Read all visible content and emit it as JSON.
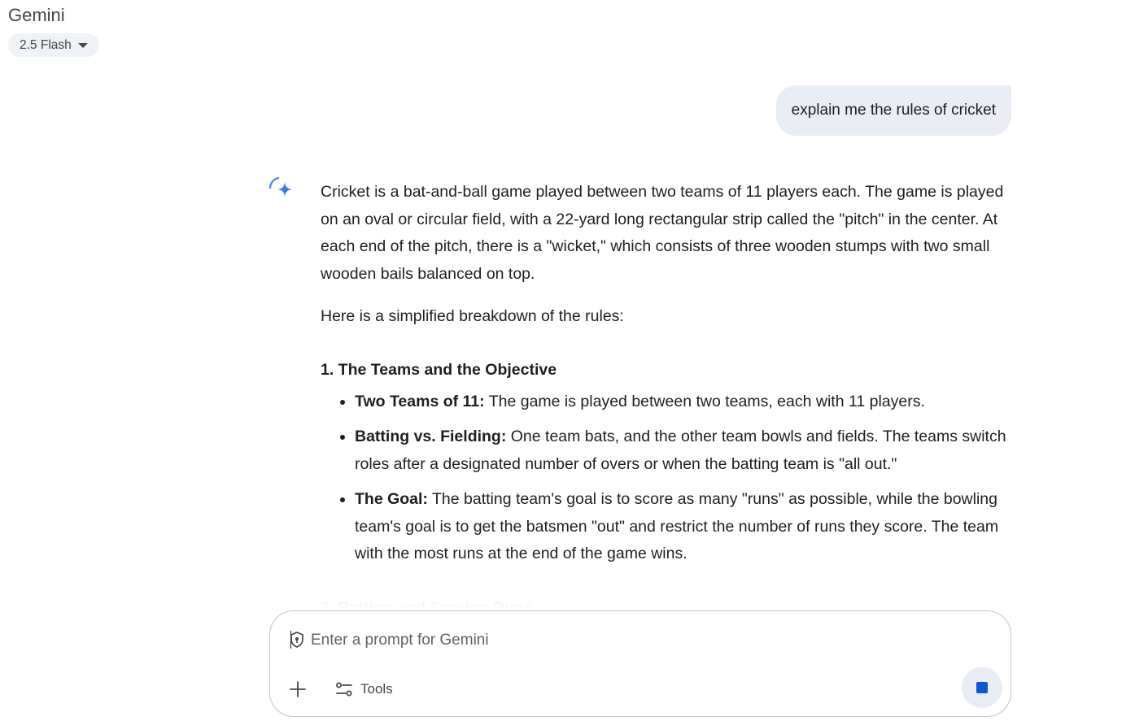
{
  "header": {
    "title": "Gemini",
    "model_label": "2.5 Flash"
  },
  "user_message": "explain me the rules of cricket",
  "response": {
    "intro": "Cricket is a bat-and-ball game played between two teams of 11 players each. The game is played on an oval or circular field, with a 22-yard long rectangular strip called the \"pitch\" in the center. At each end of the pitch, there is a \"wicket,\" which consists of three wooden stumps with two small wooden bails balanced on top.",
    "lead": "Here is a simplified breakdown of the rules:",
    "section1_heading": "1. The Teams and the Objective",
    "bullets": [
      {
        "label": "Two Teams of 11:",
        "text": " The game is played between two teams, each with 11 players."
      },
      {
        "label": "Batting vs. Fielding:",
        "text": " One team bats, and the other team bowls and fields. The teams switch roles after a designated number of overs or when the batting team is \"all out.\""
      },
      {
        "label": "The Goal:",
        "text": " The batting team's goal is to score as many \"runs\" as possible, while the bowling team's goal is to get the batsmen \"out\" and restrict the number of runs they score. The team with the most runs at the end of the game wins."
      }
    ],
    "section2_heading": "2. Batting and Scoring Runs"
  },
  "composer": {
    "placeholder": "Enter a prompt for Gemini",
    "value": "",
    "tools_label": "Tools"
  },
  "icons": {
    "model_dropdown": "caret-down-icon",
    "response_avatar": "gemini-spark-icon",
    "privacy": "shield-icon",
    "add": "plus-icon",
    "tools": "tools-sliders-icon",
    "stop": "stop-icon"
  },
  "colors": {
    "accent_blue": "#0b57d0",
    "bubble_bg": "#e9eef6",
    "chip_bg": "#eff2f6"
  }
}
